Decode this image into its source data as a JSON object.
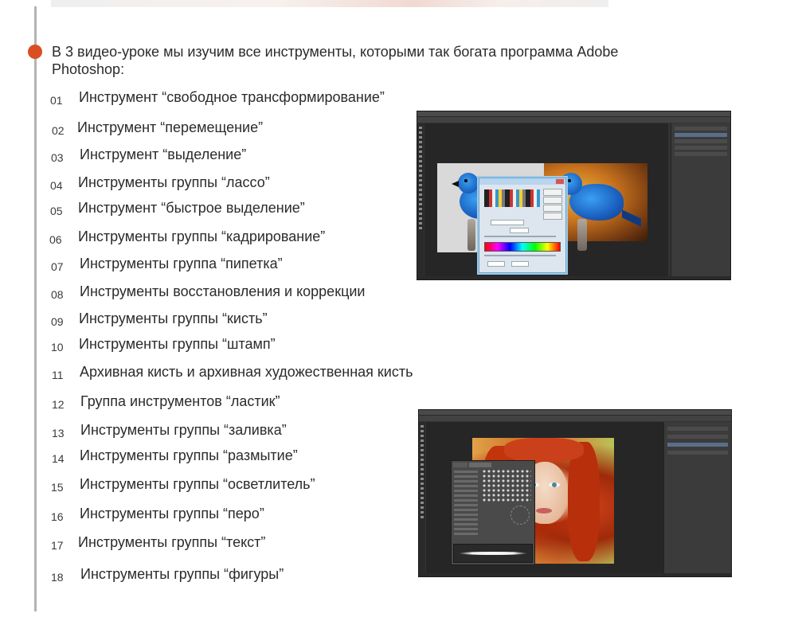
{
  "lesson": {
    "intro": "В 3 видео-уроке мы изучим все инструменты, которыми так богата программа Adobe Photoshop:",
    "accent_color": "#d94f23"
  },
  "tools": [
    {
      "num": "01",
      "label": "Инструмент “свободное трансформирование”"
    },
    {
      "num": "02",
      "label": "Инструмент “перемещение”"
    },
    {
      "num": "03",
      "label": "Инструмент “выделение”"
    },
    {
      "num": "04",
      "label": "Инструменты группы “лассо”"
    },
    {
      "num": "05",
      "label": "Инструмент “быстрое выделение”"
    },
    {
      "num": "06",
      "label": "Инструменты группы “кадрирование”"
    },
    {
      "num": "07",
      "label": "Инструменты группа “пипетка”"
    },
    {
      "num": "08",
      "label": "Инструменты восстановления и коррекции"
    },
    {
      "num": "09",
      "label": "Инструменты группы “кисть”"
    },
    {
      "num": "10",
      "label": "Инструменты группы “штамп”"
    },
    {
      "num": "11",
      "label": "Архивная кисть и архивная художественная кисть"
    },
    {
      "num": "12",
      "label": "Группа инструментов “ластик”"
    },
    {
      "num": "13",
      "label": "Инструменты группы “заливка”"
    },
    {
      "num": "14",
      "label": "Инструменты группы “размытие”"
    },
    {
      "num": "15",
      "label": "Инструменты группы “осветлитель”"
    },
    {
      "num": "16",
      "label": "Инструменты группы “перо”"
    },
    {
      "num": "17",
      "label": "Инструменты группы “текст”"
    },
    {
      "num": "18",
      "label": "Инструменты группы “фигуры”"
    }
  ]
}
